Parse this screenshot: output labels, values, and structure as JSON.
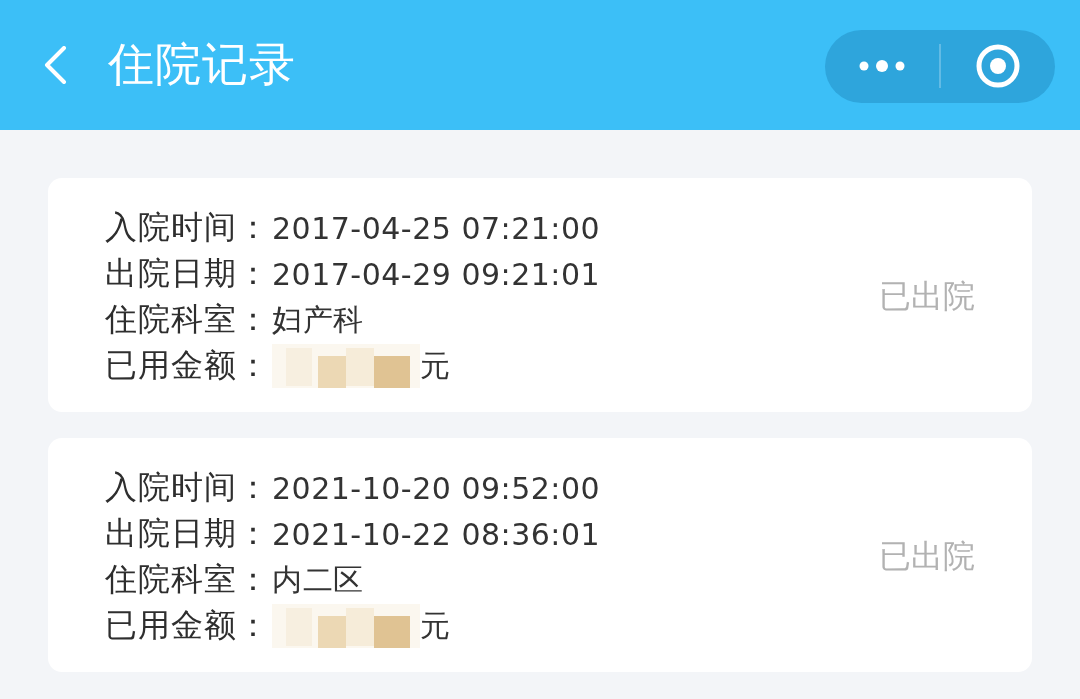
{
  "nav_bar": {
    "title": "住院记录"
  },
  "records": [
    {
      "fields": [
        {
          "label": "入院时间：",
          "value": "2017-04-25 07:21:00",
          "redacted": false
        },
        {
          "label": "出院日期：",
          "value": "2017-04-29 09:21:01",
          "redacted": false
        },
        {
          "label": "住院科室：",
          "value": "妇产科",
          "redacted": false
        },
        {
          "label": "已用金额：",
          "value": "元",
          "redacted": true
        }
      ],
      "status": "已出院"
    },
    {
      "fields": [
        {
          "label": "入院时间：",
          "value": "2021-10-20 09:52:00",
          "redacted": false
        },
        {
          "label": "出院日期：",
          "value": "2021-10-22 08:36:01",
          "redacted": false
        },
        {
          "label": "住院科室：",
          "value": "内二区",
          "redacted": false
        },
        {
          "label": "已用金额：",
          "value": "元",
          "redacted": true
        }
      ],
      "status": "已出院"
    }
  ]
}
